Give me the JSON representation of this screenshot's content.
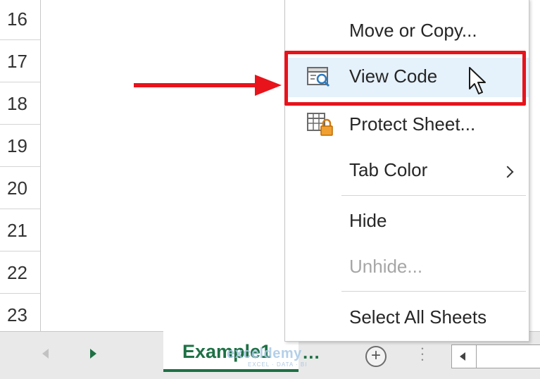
{
  "row_headers": [
    "16",
    "17",
    "18",
    "19",
    "20",
    "21",
    "22",
    "23"
  ],
  "context_menu": {
    "items": [
      {
        "label": "Move or Copy...",
        "icon": ""
      },
      {
        "label": "View Code",
        "icon": "view-code-icon",
        "highlighted": true
      },
      {
        "label": "Protect Sheet...",
        "icon": "protect-sheet-icon"
      },
      {
        "label": "Tab Color",
        "icon": "",
        "submenu": true
      },
      {
        "label": "Hide",
        "icon": ""
      },
      {
        "label": "Unhide...",
        "icon": "",
        "disabled": true
      },
      {
        "label": "Select All Sheets",
        "icon": ""
      }
    ]
  },
  "sheet_tabs": {
    "active_tab": "Example1",
    "overflow": "...",
    "add_sheet": "+"
  },
  "watermark": {
    "brand": "exceldemy",
    "tagline": "EXCEL · DATA · BI"
  },
  "colors": {
    "excel_green": "#1e7145",
    "highlight_red": "#e8131b",
    "menu_hover": "#e5f1fb"
  }
}
